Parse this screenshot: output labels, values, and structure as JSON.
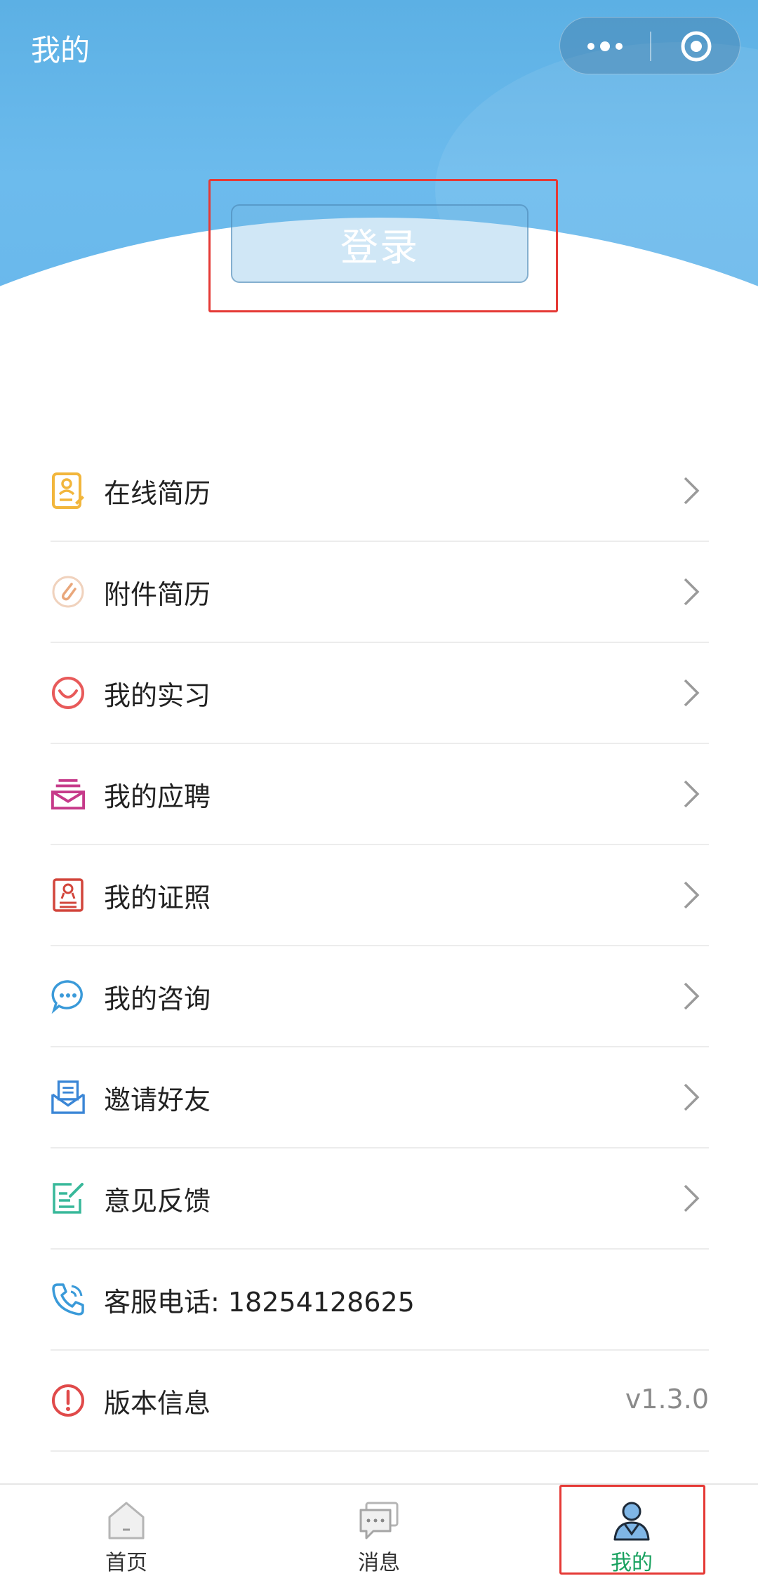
{
  "header": {
    "title": "我的",
    "login_label": "登录",
    "capsule": {
      "more_icon": "more-dots-icon",
      "close_icon": "target-circle-icon"
    }
  },
  "menu": {
    "items": [
      {
        "label": "在线简历",
        "icon": "online-resume-icon",
        "color": "#f2b63c"
      },
      {
        "label": "附件简历",
        "icon": "paperclip-icon",
        "color": "#e9a77b"
      },
      {
        "label": "我的实习",
        "icon": "smile-icon",
        "color": "#e85a5a"
      },
      {
        "label": "我的应聘",
        "icon": "inbox-icon",
        "color": "#c63a8a"
      },
      {
        "label": "我的证照",
        "icon": "certificate-icon",
        "color": "#d2453b"
      },
      {
        "label": "我的咨询",
        "icon": "chat-bubble-icon",
        "color": "#3a9ad9"
      },
      {
        "label": "邀请好友",
        "icon": "invite-mail-icon",
        "color": "#3a86d6"
      },
      {
        "label": "意见反馈",
        "icon": "feedback-edit-icon",
        "color": "#38b89a"
      },
      {
        "label": "客服电话: 18254128625",
        "icon": "phone-icon",
        "color": "#3a9ad9"
      },
      {
        "label": "版本信息",
        "icon": "alert-circle-icon",
        "color": "#e04a4a",
        "value": "v1.3.0"
      }
    ]
  },
  "tabbar": {
    "tabs": [
      {
        "label": "首页",
        "icon": "home-icon"
      },
      {
        "label": "消息",
        "icon": "message-icon"
      },
      {
        "label": "我的",
        "icon": "profile-icon",
        "active": true
      }
    ],
    "active_color": "#1aa260"
  },
  "colors": {
    "header_blue": "#62b4e8",
    "highlight_red": "#e53935"
  }
}
